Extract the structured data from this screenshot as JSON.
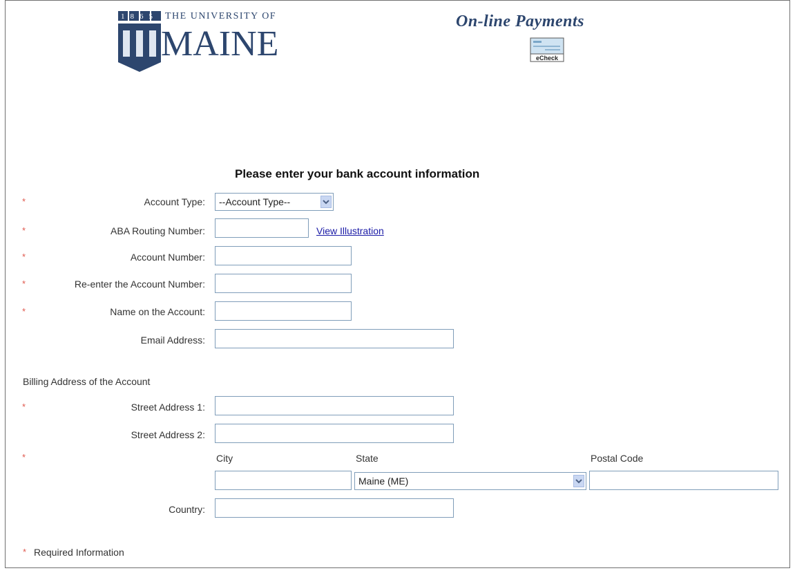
{
  "header": {
    "logo": {
      "year": "1865",
      "top_text": "THE UNIVERSITY OF",
      "name": "MAINE"
    },
    "title": "On-line Payments",
    "echeck_label": "eCheck"
  },
  "form": {
    "heading": "Please enter your bank account information",
    "required_mark": "*",
    "account_type": {
      "label": "Account Type:",
      "selected": "--Account Type--"
    },
    "routing": {
      "label": "ABA Routing Number:",
      "value": "",
      "link": "View Illustration"
    },
    "account_number": {
      "label": "Account Number:",
      "value": ""
    },
    "reenter": {
      "label": "Re-enter the Account Number:",
      "value": ""
    },
    "name": {
      "label": "Name on the Account:",
      "value": ""
    },
    "email": {
      "label": "Email Address:",
      "value": ""
    },
    "billing_heading": "Billing Address of the Account",
    "street1": {
      "label": "Street Address 1:",
      "value": ""
    },
    "street2": {
      "label": "Street Address 2:",
      "value": ""
    },
    "city": {
      "label": "City",
      "value": ""
    },
    "state": {
      "label": "State",
      "selected": "Maine (ME)"
    },
    "postal": {
      "label": "Postal Code",
      "value": ""
    },
    "country": {
      "label": "Country:",
      "value": ""
    },
    "required_note": "Required Information"
  },
  "colors": {
    "accent": "#2d466e",
    "required": "#e05a4f",
    "link": "#1a1aa6",
    "input_border": "#7f9db9"
  }
}
